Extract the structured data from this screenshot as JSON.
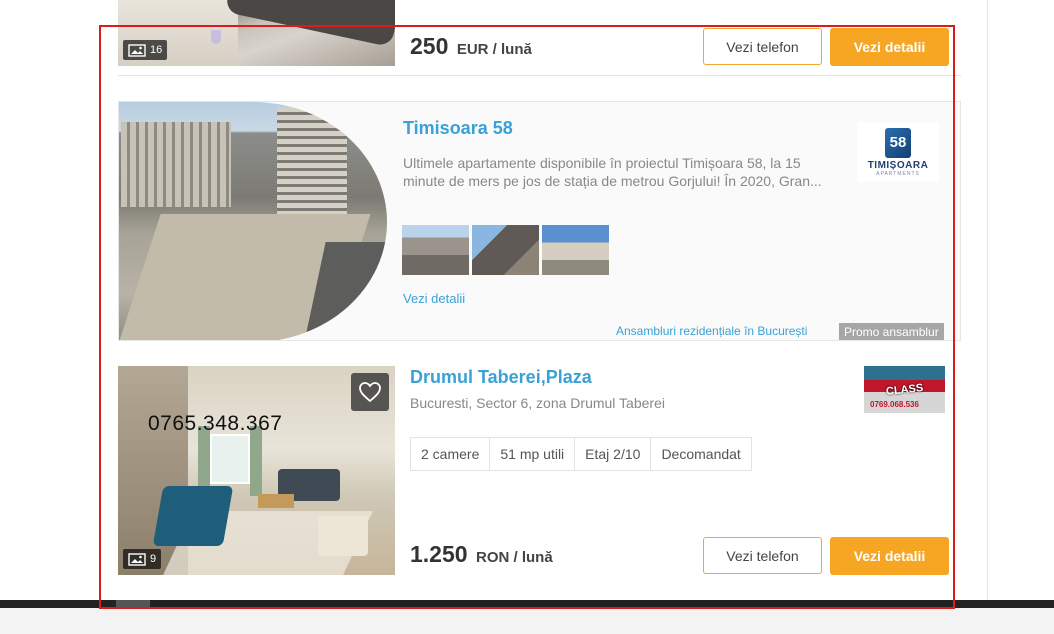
{
  "listing_top": {
    "photo_count": "16",
    "price_amount": "250",
    "price_unit": "EUR / lună",
    "phone_button": "Vezi telefon",
    "details_button": "Vezi detalii"
  },
  "promo": {
    "title": "Timisoara 58",
    "description": "Ultimele apartamente disponibile în proiectul Timișoara 58, la 15 minute de mers pe jos de stația de metrou Gorjului! În 2020, Gran...",
    "details_link": "Vezi detalii",
    "logo_mark": "58",
    "logo_brand": "TIMIȘOARA",
    "logo_sub": "APARTMENTS",
    "category_link": "Ansambluri rezidențiale în București",
    "badge": "Promo ansamblur"
  },
  "listing_bottom": {
    "photo_count": "9",
    "phone_overlay": "0765.348.367",
    "title": "Drumul Taberei,Plaza",
    "location": "Bucuresti, Sector 6, zona Drumul Taberei",
    "features": [
      "2 camere",
      "51 mp utili",
      "Etaj 2/10",
      "Decomandat"
    ],
    "agency_logo_text": "CLASS",
    "agency_logo_phone": "0769.068.536",
    "price_amount": "1.250",
    "price_unit": "RON / lună",
    "phone_button": "Vezi telefon",
    "details_button": "Vezi detalii"
  },
  "colors": {
    "accent_orange": "#f6a623",
    "link_blue": "#3aa1d6",
    "highlight_red": "#d91c1c"
  }
}
